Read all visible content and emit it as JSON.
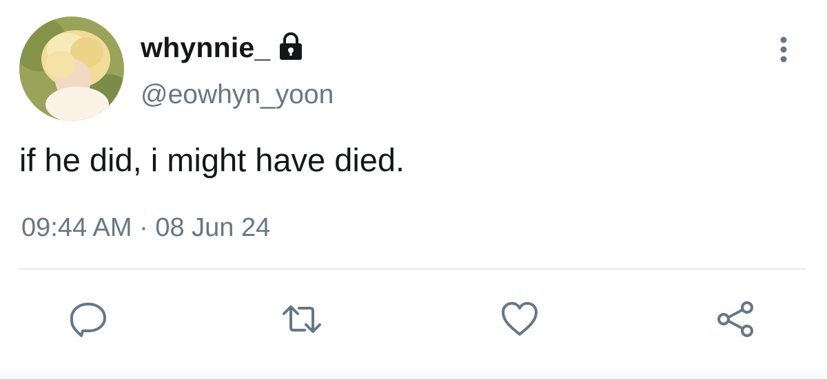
{
  "tweet": {
    "display_name": "whynnie_",
    "handle": "@eowhyn_yoon",
    "text": "if he did, i might have died.",
    "time": "09:44 AM",
    "separator": "·",
    "date": "08 Jun 24"
  },
  "icons": {
    "lock": "lock-icon",
    "more": "more-vertical-icon",
    "reply": "reply-icon",
    "retweet": "retweet-icon",
    "like": "heart-icon",
    "share": "share-icon"
  },
  "colors": {
    "text_primary": "#14171a",
    "text_secondary": "#657786",
    "divider": "#e6ecf0"
  }
}
